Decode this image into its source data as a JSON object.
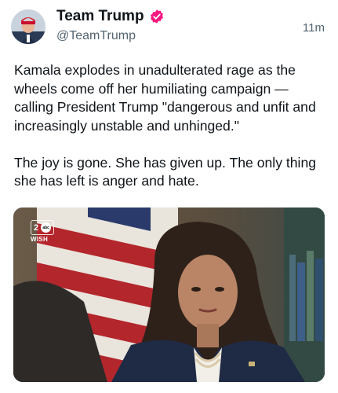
{
  "author": {
    "display_name": "Team Trump",
    "handle": "@TeamTrump",
    "verified_icon": "verified-badge-icon",
    "verified_color": "#F91880"
  },
  "timestamp": "11m",
  "post": {
    "text": "Kamala explodes in unadulterated rage as the wheels come off her humiliating campaign — calling President Trump \"dangerous and unfit and increasingly unstable and unhinged.\"\n\nThe joy is gone. She has given up. The only thing she has left is anger and hate."
  },
  "media": {
    "kind": "video-still",
    "watermark": {
      "channel_number": "2",
      "network": "abc",
      "station": "WISH"
    }
  }
}
